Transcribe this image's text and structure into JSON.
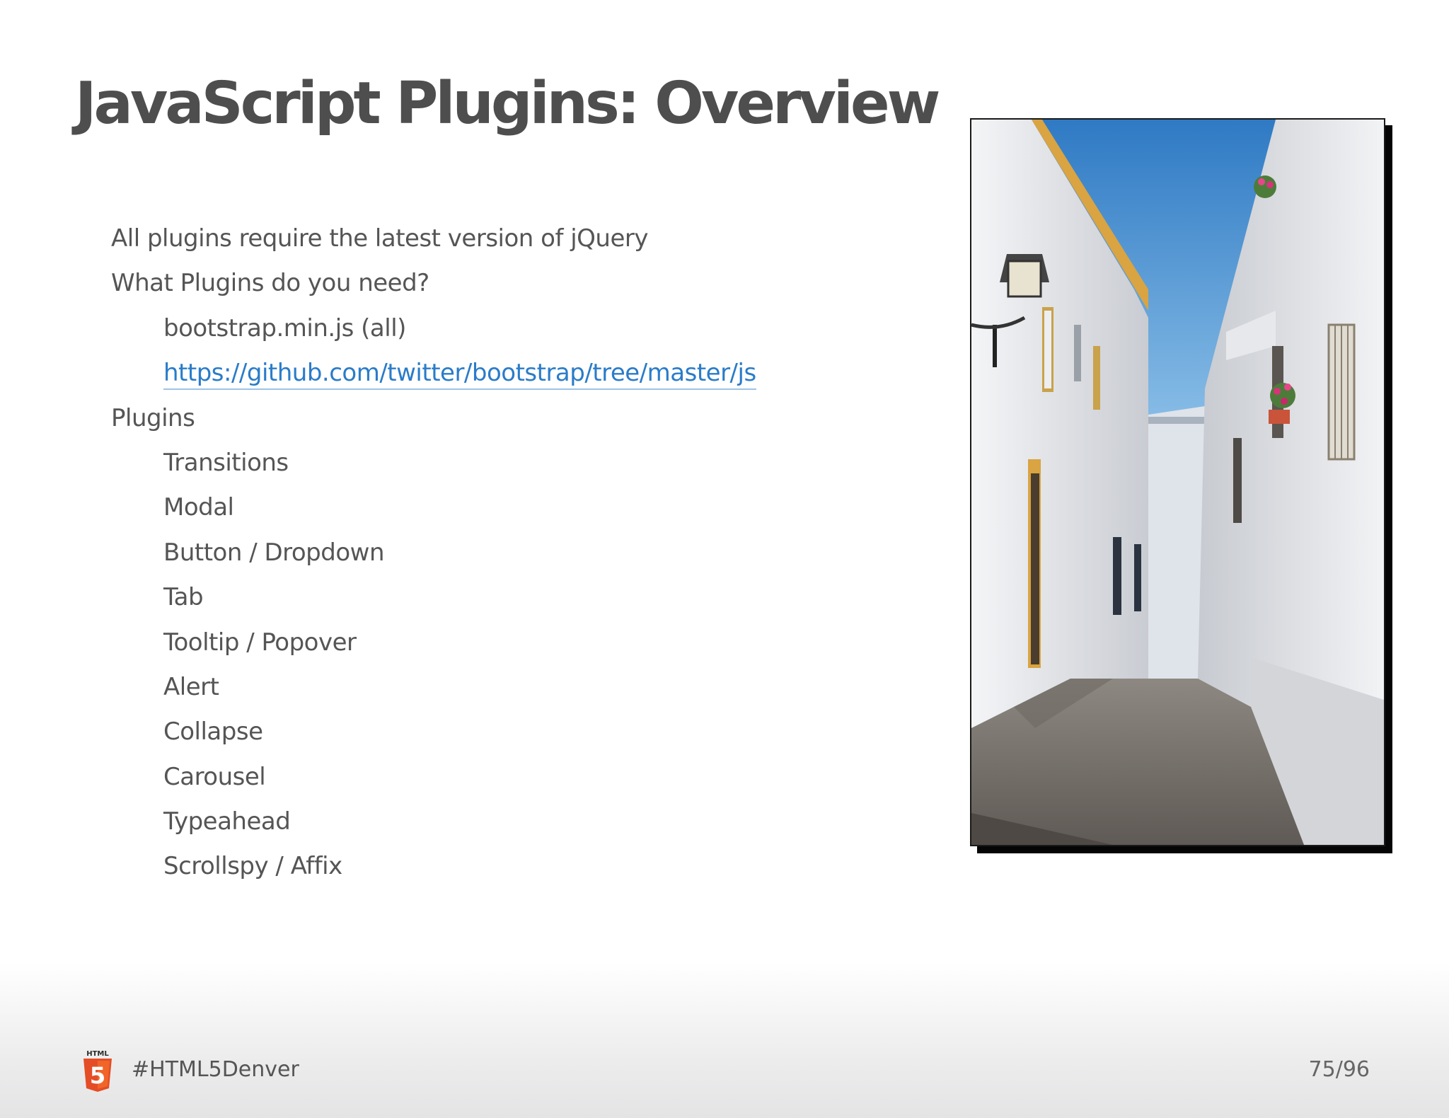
{
  "slide": {
    "title": "JavaScript Plugins: Overview",
    "bullets": [
      {
        "text": "All plugins require the latest version of jQuery",
        "level": 1
      },
      {
        "text": "What Plugins do you need?",
        "level": 1
      },
      {
        "text": "bootstrap.min.js (all)",
        "level": 2
      },
      {
        "text": "https://github.com/twitter/bootstrap/tree/master/js",
        "level": 2,
        "link": true
      },
      {
        "text": "Plugins",
        "level": 1
      },
      {
        "text": "Transitions",
        "level": 2
      },
      {
        "text": "Modal",
        "level": 2
      },
      {
        "text": "Button / Dropdown",
        "level": 2
      },
      {
        "text": "Tab",
        "level": 2
      },
      {
        "text": "Tooltip / Popover",
        "level": 2
      },
      {
        "text": "Alert",
        "level": 2
      },
      {
        "text": "Collapse",
        "level": 2
      },
      {
        "text": "Carousel",
        "level": 2
      },
      {
        "text": "Typeahead",
        "level": 2
      },
      {
        "text": "Scrollspy / Affix",
        "level": 2
      }
    ]
  },
  "footer": {
    "logo_text": "HTML",
    "logo_number": "5",
    "hashtag": "#HTML5Denver",
    "page": "75/96"
  },
  "colors": {
    "title": "#4e4e4e",
    "text": "#555555",
    "link": "#2a7cc9",
    "html5_orange": "#e44d26"
  },
  "icons": {
    "footer_logo": "html5-logo-icon"
  }
}
